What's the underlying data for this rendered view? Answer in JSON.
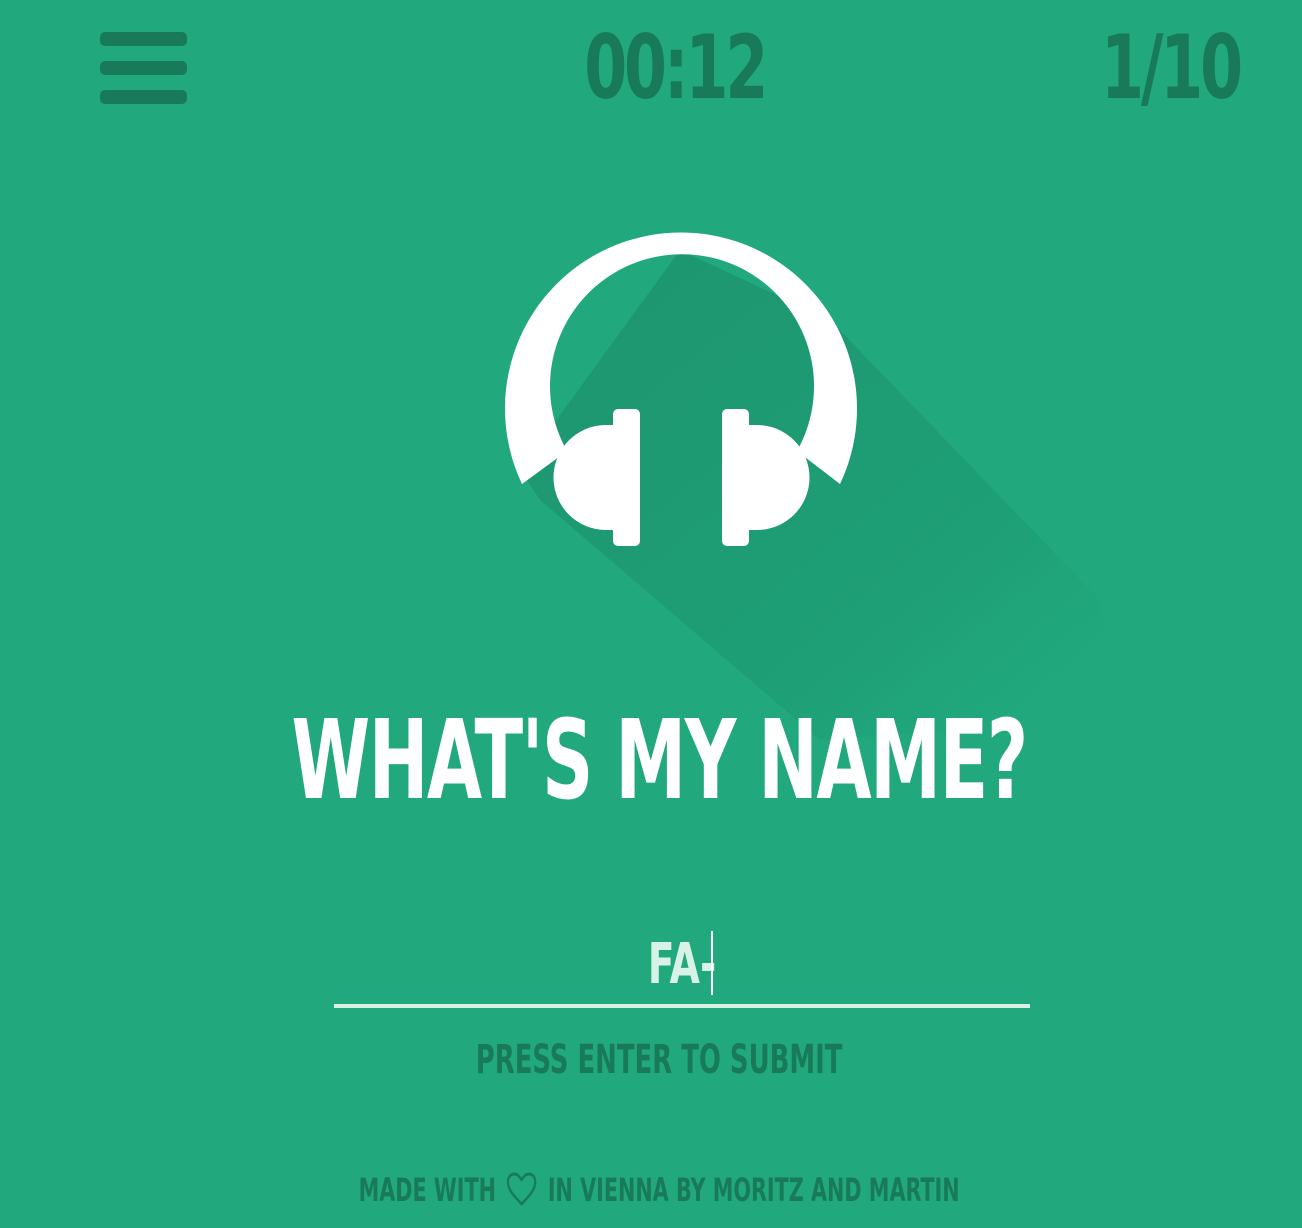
{
  "header": {
    "timer": "00:12",
    "progress": "1/10"
  },
  "main": {
    "icon": "headphones-icon",
    "question": "WHAT'S MY NAME?",
    "answer_value": "FA-",
    "hint": "PRESS ENTER TO SUBMIT"
  },
  "footer": {
    "made_with": "MADE WITH",
    "in_vienna": "IN VIENNA BY MORITZ AND MARTIN",
    "icon": "heart-icon"
  },
  "colors": {
    "background": "#21a97d",
    "dark_accent": "#197a59",
    "text_light": "#ffffff",
    "input_text": "#d8f2e7"
  }
}
